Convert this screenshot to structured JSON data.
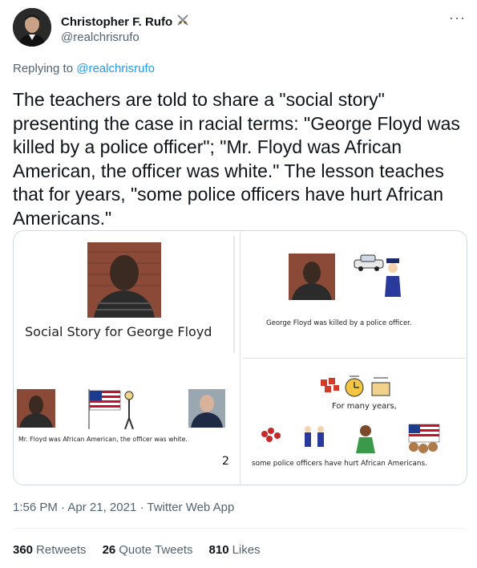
{
  "author": {
    "name": "Christopher F. Rufo",
    "handle": "@realchrisrufo",
    "badge_icon": "crossed-swords-emoji"
  },
  "more_label": "···",
  "reply": {
    "prefix": "Replying to ",
    "mention": "@realchrisrufo"
  },
  "tweet_text": "The teachers are told to share a \"social story\" presenting the case in racial terms: \"George Floyd was killed by a police officer\"; \"Mr. Floyd was African American, the officer was white.\" The lesson teaches that for years, \"some police officers have hurt African Americans.\"",
  "media": {
    "panel1": {
      "title": "Social Story  for  George Floyd"
    },
    "panel2": {
      "caption": "George Floyd was killed by a police officer."
    },
    "panel3": {
      "caption": "Mr. Floyd was African American, the officer was white.",
      "page_number": "2"
    },
    "panel4": {
      "caption_top": "For many years,",
      "caption_bottom": "some police officers have hurt African Americans."
    }
  },
  "meta": {
    "time": "1:56 PM",
    "sep1": " · ",
    "date": "Apr 21, 2021",
    "sep2": " · ",
    "source": "Twitter Web App"
  },
  "stats": {
    "retweets_count": "360",
    "retweets_label": "Retweets",
    "quotes_count": "26",
    "quotes_label": "Quote Tweets",
    "likes_count": "810",
    "likes_label": "Likes"
  },
  "colors": {
    "text": "#0f1419",
    "secondary": "#536471",
    "link": "#1d9bf0",
    "border": "#cfd9de"
  }
}
